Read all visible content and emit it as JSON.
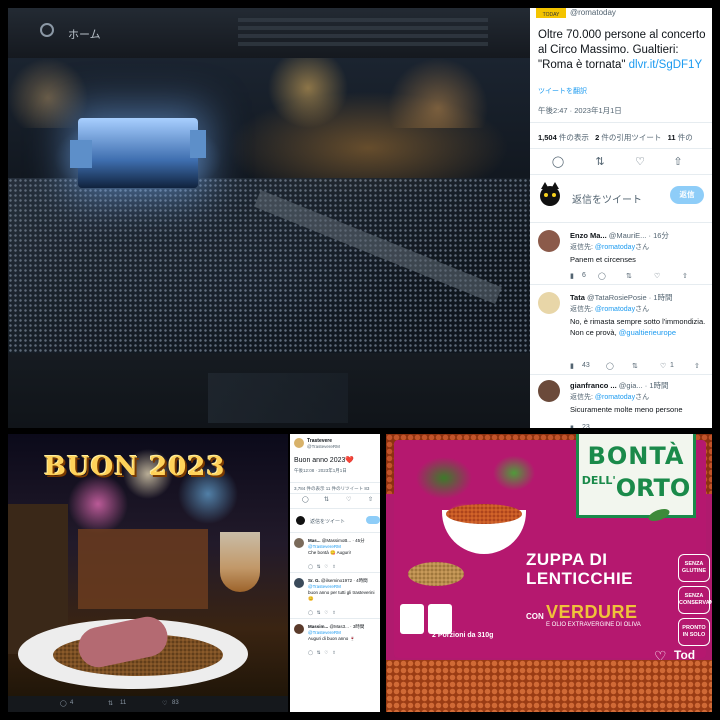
{
  "concert_panel": {
    "bg_header_home": "ホーム"
  },
  "tweet_main": {
    "logo_text": "TODAY",
    "handle": "@romatoday",
    "text_before_link": "Oltre 70.000 persone al concerto al Circo Massimo. Gualtieri: \"Roma è tornata\" ",
    "link": "dlvr.it/SgDF1Y",
    "translate": "ツイートを翻訳",
    "timestamp": "午後2:47 · 2023年1月1日",
    "views_count": "1,504",
    "views_label": "件の表示",
    "quotes_count": "2",
    "quotes_label": "件の引用ツイート",
    "likes_count": "11",
    "likes_label": "件の",
    "reply_placeholder": "返信をツイート",
    "reply_button": "返信",
    "replies": [
      {
        "name": "Enzo Ma...",
        "handle": "@MauriE...",
        "time": "· 16分",
        "reply_to_label": "返信先: ",
        "reply_to": "@romatoday",
        "reply_to_suffix": "さん",
        "text": "Panem et circenses",
        "mention": "",
        "replies": "6",
        "likes": ""
      },
      {
        "name": "Tata",
        "handle": "@TataRosiePosie",
        "time": "· 1時間",
        "reply_to_label": "返信先: ",
        "reply_to": "@romatoday",
        "reply_to_suffix": "さん",
        "text": "No, è rimasta sempre sotto l'immondizia. Non ce provà, ",
        "mention": "@gualtierieurope",
        "replies": "43",
        "likes": "1"
      },
      {
        "name": "gianfranco ...",
        "handle": "@gia...",
        "time": "· 1時間",
        "reply_to_label": "返信先: ",
        "reply_to": "@romatoday",
        "reply_to_suffix": "さん",
        "text": "Sicuramente molte meno persone",
        "mention": "",
        "replies": "23",
        "likes": ""
      }
    ]
  },
  "buon_anno_panel": {
    "title": "BUON 2023",
    "footer_counts": [
      "4",
      "11",
      "83"
    ]
  },
  "tweet_mini": {
    "name": "Trastevere",
    "handle": "@TrastevereRM",
    "body": "Buon anno 2023",
    "heart": "❤️",
    "time": "午後12:08 · 2023年1月1日",
    "stats": "3,784 件の表示  11 件のリツイート  83",
    "reply_placeholder": "返信をツイート",
    "replies": [
      {
        "name": "Mas...",
        "handle": "@MassimoB...",
        "time": "· 45分",
        "to": "@TrastevereRM",
        "text": "Che bontà 😋 Auguri!"
      },
      {
        "name": "Sr. G.",
        "handle": "@ilsemino1972",
        "time": "· 4時間",
        "to": "@TrastevereRM",
        "text": "buon anno per tutti gli trasteverini 😊"
      },
      {
        "name": "Massim...",
        "handle": "@Mas3...",
        "time": "· 3時間",
        "to": "@TrastevereRM",
        "text": "Auguri di buon anno 🍷"
      }
    ]
  },
  "product_panel": {
    "brand_line1": "BONTÀ",
    "brand_line2_small": "DELL'",
    "brand_line2": "ORTO",
    "name": "ZUPPA DI LENTICCHIE",
    "con": "CON",
    "verdure": "VERDURE",
    "olio": "E OLIO EXTRAVERGINE DI OLIVA",
    "portions": "2 Porzioni da 310g",
    "badges": [
      "SENZA GLUTINE",
      "SENZA CONSERVANTI",
      "PRONTO IN SOLO"
    ],
    "tod": "Tod"
  }
}
